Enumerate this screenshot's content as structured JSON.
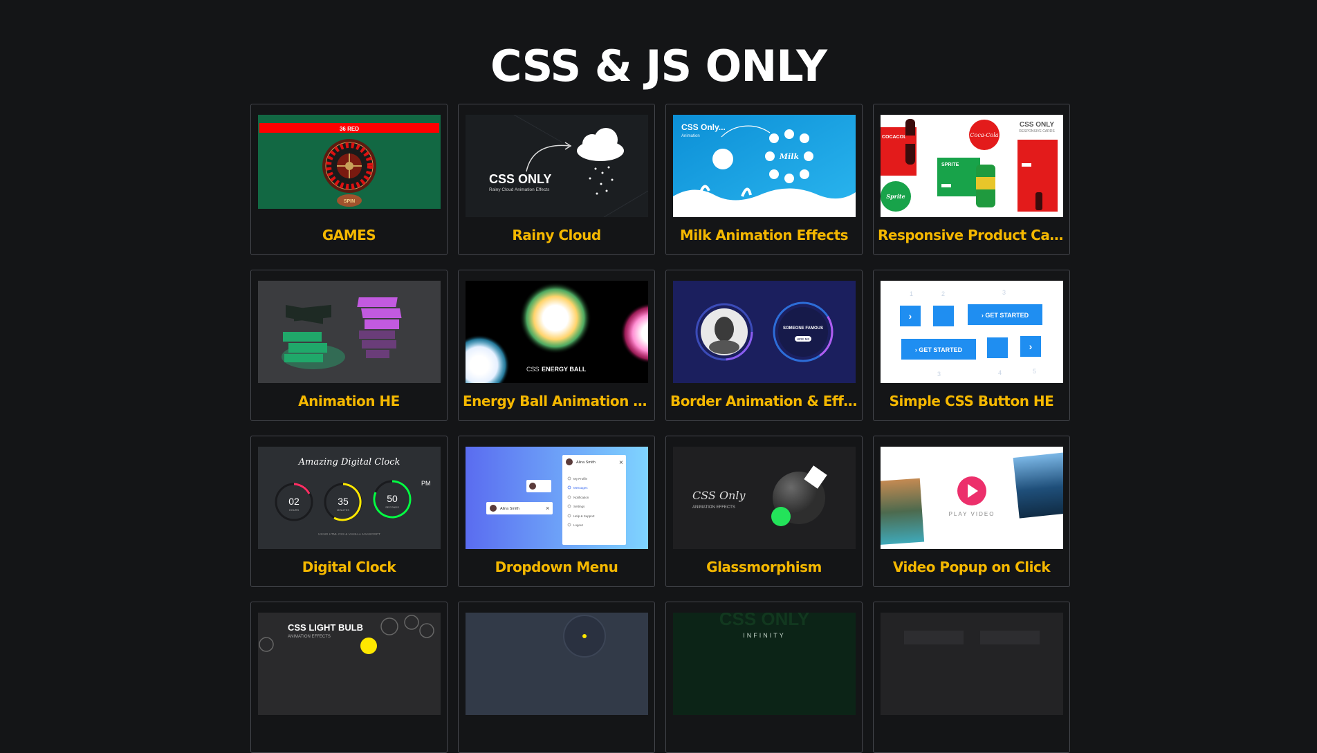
{
  "page": {
    "title": "CSS & JS ONLY"
  },
  "cards": [
    {
      "title": "GAMES",
      "thumb": "roulette-game-thumbnail",
      "thumb_text": [
        "36 RED",
        "SPIN"
      ]
    },
    {
      "title": "Rainy Cloud",
      "thumb": "rainy-cloud-thumbnail",
      "thumb_text": [
        "CSS ONLY",
        "Rainy Cloud Animation Effects"
      ]
    },
    {
      "title": "Milk Animation Effects",
      "thumb": "milk-animation-thumbnail",
      "thumb_text": [
        "CSS Only...",
        "Animation",
        "Milk"
      ]
    },
    {
      "title": "Responsive Product Card",
      "thumb": "product-card-thumbnail",
      "thumb_text": [
        "CSS ONLY",
        "RESPONSIVE CARDS",
        "COCACOLA",
        "SPRITE",
        "Sprite"
      ]
    },
    {
      "title": "Animation HE",
      "thumb": "animation-he-thumbnail",
      "thumb_text": []
    },
    {
      "title": "Energy Ball Animation Effects",
      "thumb": "energy-ball-thumbnail",
      "thumb_text": [
        "CSS",
        "ENERGY BALL"
      ]
    },
    {
      "title": "Border Animation & Effects",
      "thumb": "border-animation-thumbnail",
      "thumb_text": [
        "SOMEONE FAMOUS",
        "HIRE ME"
      ]
    },
    {
      "title": "Simple CSS Button HE",
      "thumb": "css-button-thumbnail",
      "thumb_text": [
        "GET STARTED",
        "GET STARTED",
        "1",
        "2",
        "3",
        "3",
        "4",
        "5"
      ]
    },
    {
      "title": "Digital Clock",
      "thumb": "digital-clock-thumbnail",
      "thumb_text": [
        "Amazing Digital Clock",
        "02",
        "HOURS",
        "35",
        "MINUTES",
        "50",
        "SECONDS",
        "PM",
        "USING HTML CSS & VANILLA JAVASCRIPT"
      ]
    },
    {
      "title": "Dropdown Menu",
      "thumb": "dropdown-menu-thumbnail",
      "thumb_text": [
        "Alina Smith",
        "My Profile",
        "Messages",
        "Notification",
        "Settings",
        "Help & Support",
        "Logout",
        "Alina Smith"
      ]
    },
    {
      "title": "Glassmorphism",
      "thumb": "glassmorphism-thumbnail",
      "thumb_text": [
        "CSS Only",
        "ANIMATION EFFECTS"
      ]
    },
    {
      "title": "Video Popup on Click",
      "thumb": "video-popup-thumbnail",
      "thumb_text": [
        "PLAY VIDEO"
      ]
    },
    {
      "title": "",
      "thumb": "light-bulb-thumbnail",
      "thumb_text": [
        "CSS LIGHT BULB",
        "ANIMATION EFFECTS"
      ]
    },
    {
      "title": "",
      "thumb": "analog-clock-thumbnail",
      "thumb_text": []
    },
    {
      "title": "",
      "thumb": "infinity-thumbnail",
      "thumb_text": [
        "CSS ONLY",
        "INFINITY"
      ]
    },
    {
      "title": "",
      "thumb": "placeholder-thumbnail",
      "thumb_text": []
    }
  ]
}
